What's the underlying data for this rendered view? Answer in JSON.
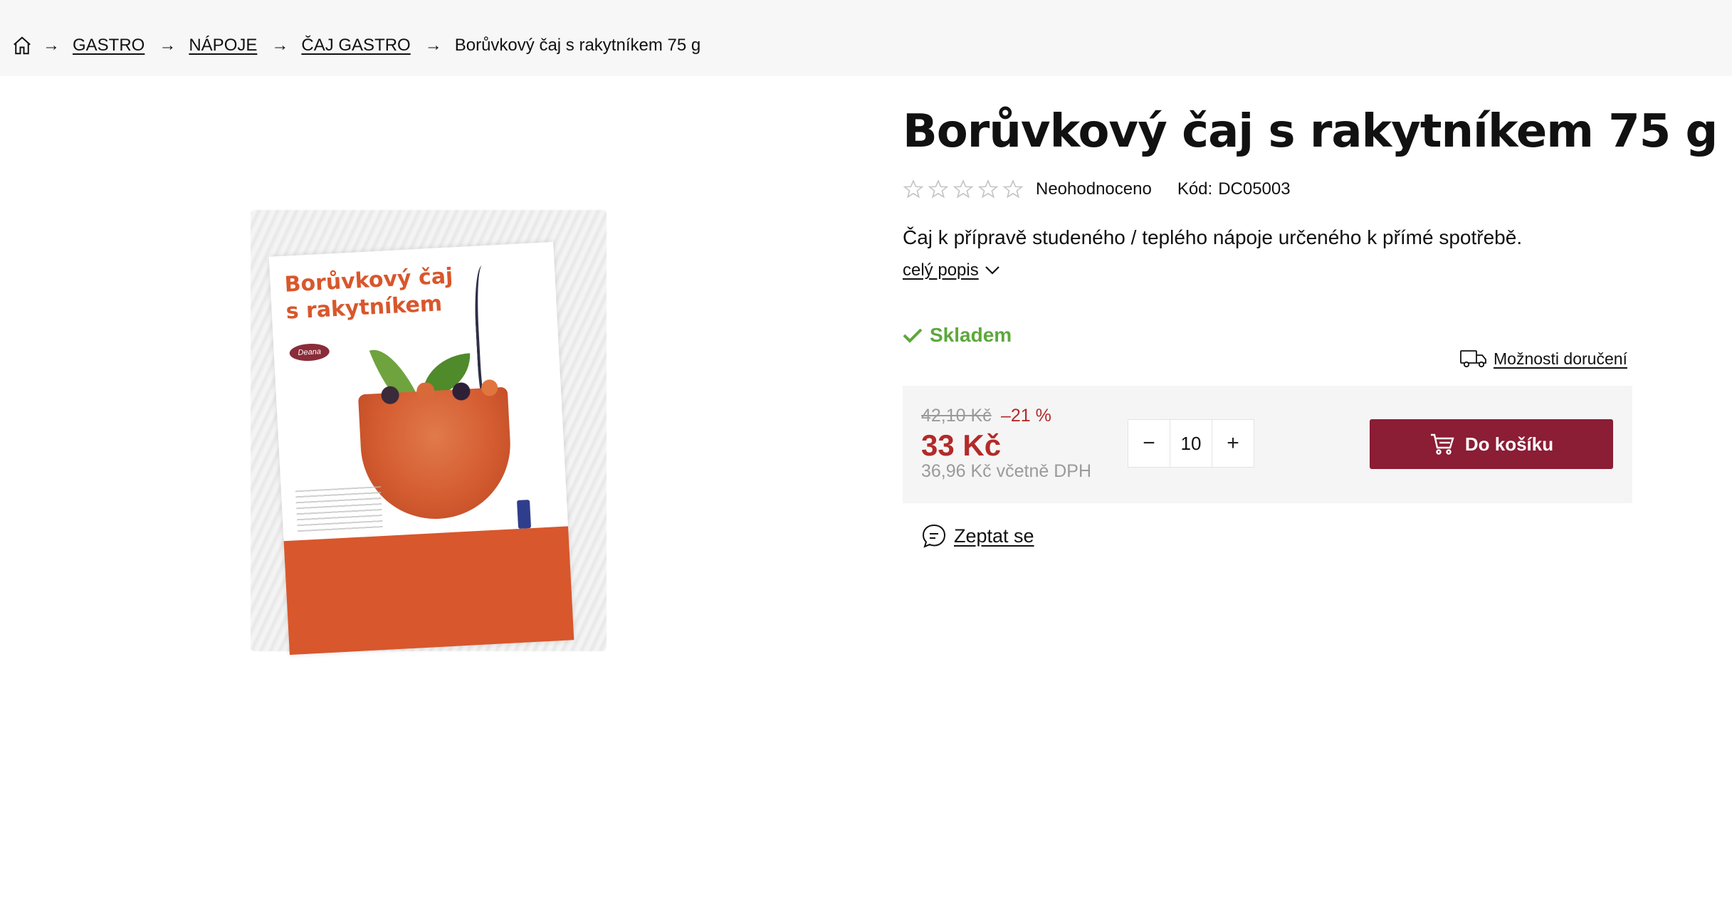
{
  "breadcrumb": {
    "home_icon": "home-icon",
    "separator": "→",
    "items": [
      "GASTRO",
      "NÁPOJE",
      "ČAJ GASTRO"
    ],
    "current": "Borůvkový čaj s rakytníkem 75 g"
  },
  "product": {
    "title": "Borůvkový čaj s rakytníkem 75 g",
    "rating": {
      "stars_filled": 0,
      "stars_total": 5,
      "text": "Neohodnoceno"
    },
    "code_label": "Kód:",
    "code_value": "DC05003",
    "description": "Čaj k přípravě studeného / teplého nápoje určeného k přímé spotřebě.",
    "more_link": "celý popis",
    "stock": "Skladem",
    "delivery_link": "Možnosti doručení",
    "image_alt_lettering": {
      "title_line1": "Borůvkový čaj",
      "title_line2": "s rakytníkem",
      "logo": "Deana"
    }
  },
  "buybox": {
    "old_price": "42,10 Kč",
    "discount": "–21 %",
    "price": "33 Kč",
    "vat_price": "36,96 Kč včetně DPH",
    "quantity": "10",
    "minus": "−",
    "plus": "+",
    "cart_label": "Do košíku"
  },
  "ask": {
    "label": "Zeptat se"
  },
  "colors": {
    "accent": "#8b1d35",
    "price": "#b32a2a",
    "stock": "#5da83c"
  }
}
